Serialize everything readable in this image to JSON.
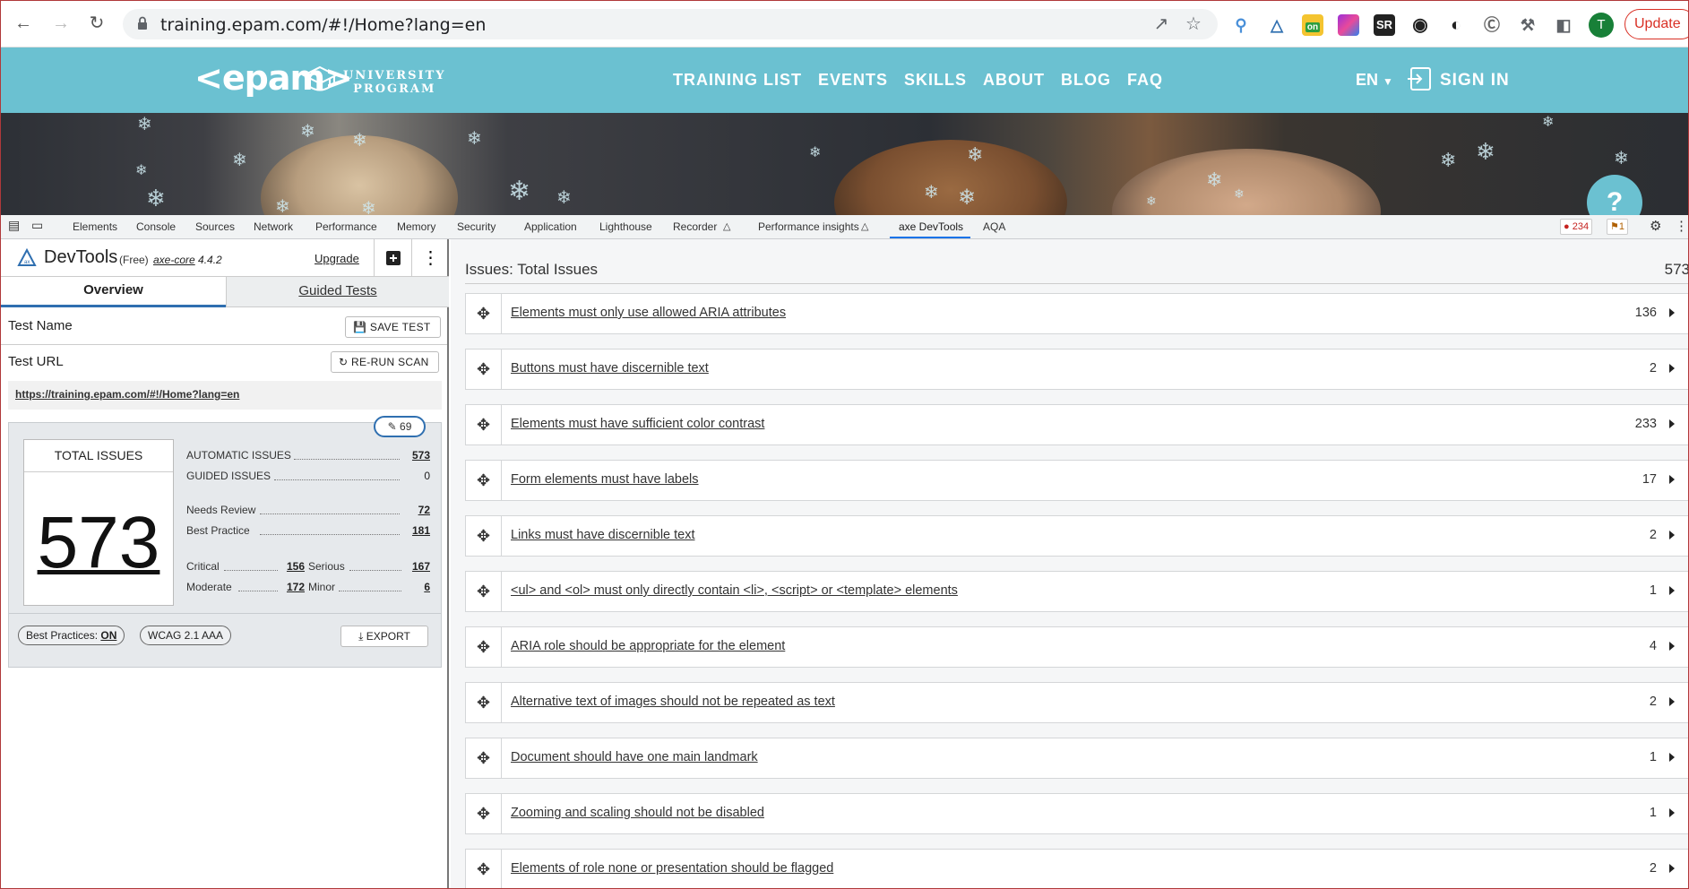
{
  "browser": {
    "url": "training.epam.com/#!/Home?lang=en",
    "update_label": "Update",
    "avatar_letter": "T",
    "extensions": [
      "zoom-search-icon",
      "axe-icon",
      "on-extension-icon",
      "color-extension-icon",
      "sr-extension-icon",
      "eye-extension-icon",
      "g-extension-icon",
      "w-extension-icon",
      "puzzle-icon",
      "sidebar-icon"
    ],
    "ext_sr": "SR",
    "ext_on": "on"
  },
  "site": {
    "logo": "<epam>",
    "program_line1": "UNIVERSITY",
    "program_line2": "PROGRAM",
    "nav": [
      "TRAINING LIST",
      "EVENTS",
      "SKILLS",
      "ABOUT",
      "BLOG",
      "FAQ"
    ],
    "lang": "EN",
    "signin": "SIGN IN",
    "help": "?"
  },
  "devtools": {
    "tabs": [
      "Elements",
      "Console",
      "Sources",
      "Network",
      "Performance",
      "Memory",
      "Security",
      "Application",
      "Lighthouse",
      "Recorder",
      "Performance insights",
      "axe DevTools",
      "AQA"
    ],
    "active_tab": "axe DevTools",
    "errors": "234",
    "warnings": "1"
  },
  "axe": {
    "title": "DevTools",
    "free": "(Free)",
    "core_label": "axe-core",
    "core_version": "4.4.2",
    "upgrade": "Upgrade",
    "tab_overview": "Overview",
    "tab_guided": "Guided Tests",
    "test_name_label": "Test Name",
    "save_test": "SAVE TEST",
    "test_url_label": "Test URL",
    "rerun": "RE-RUN SCAN",
    "tested_url": "https://training.epam.com/#!/Home?lang=en",
    "badge_count": "69",
    "total_label": "TOTAL ISSUES",
    "total": "573",
    "automatic_label": "AUTOMATIC ISSUES",
    "automatic": "573",
    "guided_label": "GUIDED ISSUES",
    "guided": "0",
    "needs_review_label": "Needs Review",
    "needs_review": "72",
    "best_practice_label": "Best Practice",
    "best_practice": "181",
    "critical_label": "Critical",
    "critical": "156",
    "serious_label": "Serious",
    "serious": "167",
    "moderate_label": "Moderate",
    "moderate": "172",
    "minor_label": "Minor",
    "minor": "6",
    "best_practices_pill": "Best Practices:",
    "best_practices_state": "ON",
    "wcag_pill": "WCAG 2.1 AAA",
    "export": "EXPORT"
  },
  "issues": {
    "title": "Issues: Total Issues",
    "total": "573",
    "items": [
      {
        "text": "Elements must only use allowed ARIA attributes",
        "count": "136"
      },
      {
        "text": "Buttons must have discernible text",
        "count": "2"
      },
      {
        "text": "Elements must have sufficient color contrast",
        "count": "233"
      },
      {
        "text": "Form elements must have labels",
        "count": "17"
      },
      {
        "text": "Links must have discernible text",
        "count": "2"
      },
      {
        "text": "<ul> and <ol> must only directly contain <li>, <script> or <template> elements",
        "count": "1"
      },
      {
        "text": "ARIA role should be appropriate for the element",
        "count": "4"
      },
      {
        "text": "Alternative text of images should not be repeated as text",
        "count": "2"
      },
      {
        "text": "Document should have one main landmark",
        "count": "1"
      },
      {
        "text": "Zooming and scaling should not be disabled",
        "count": "1"
      },
      {
        "text": "Elements of role none or presentation should be flagged",
        "count": "2"
      }
    ]
  }
}
